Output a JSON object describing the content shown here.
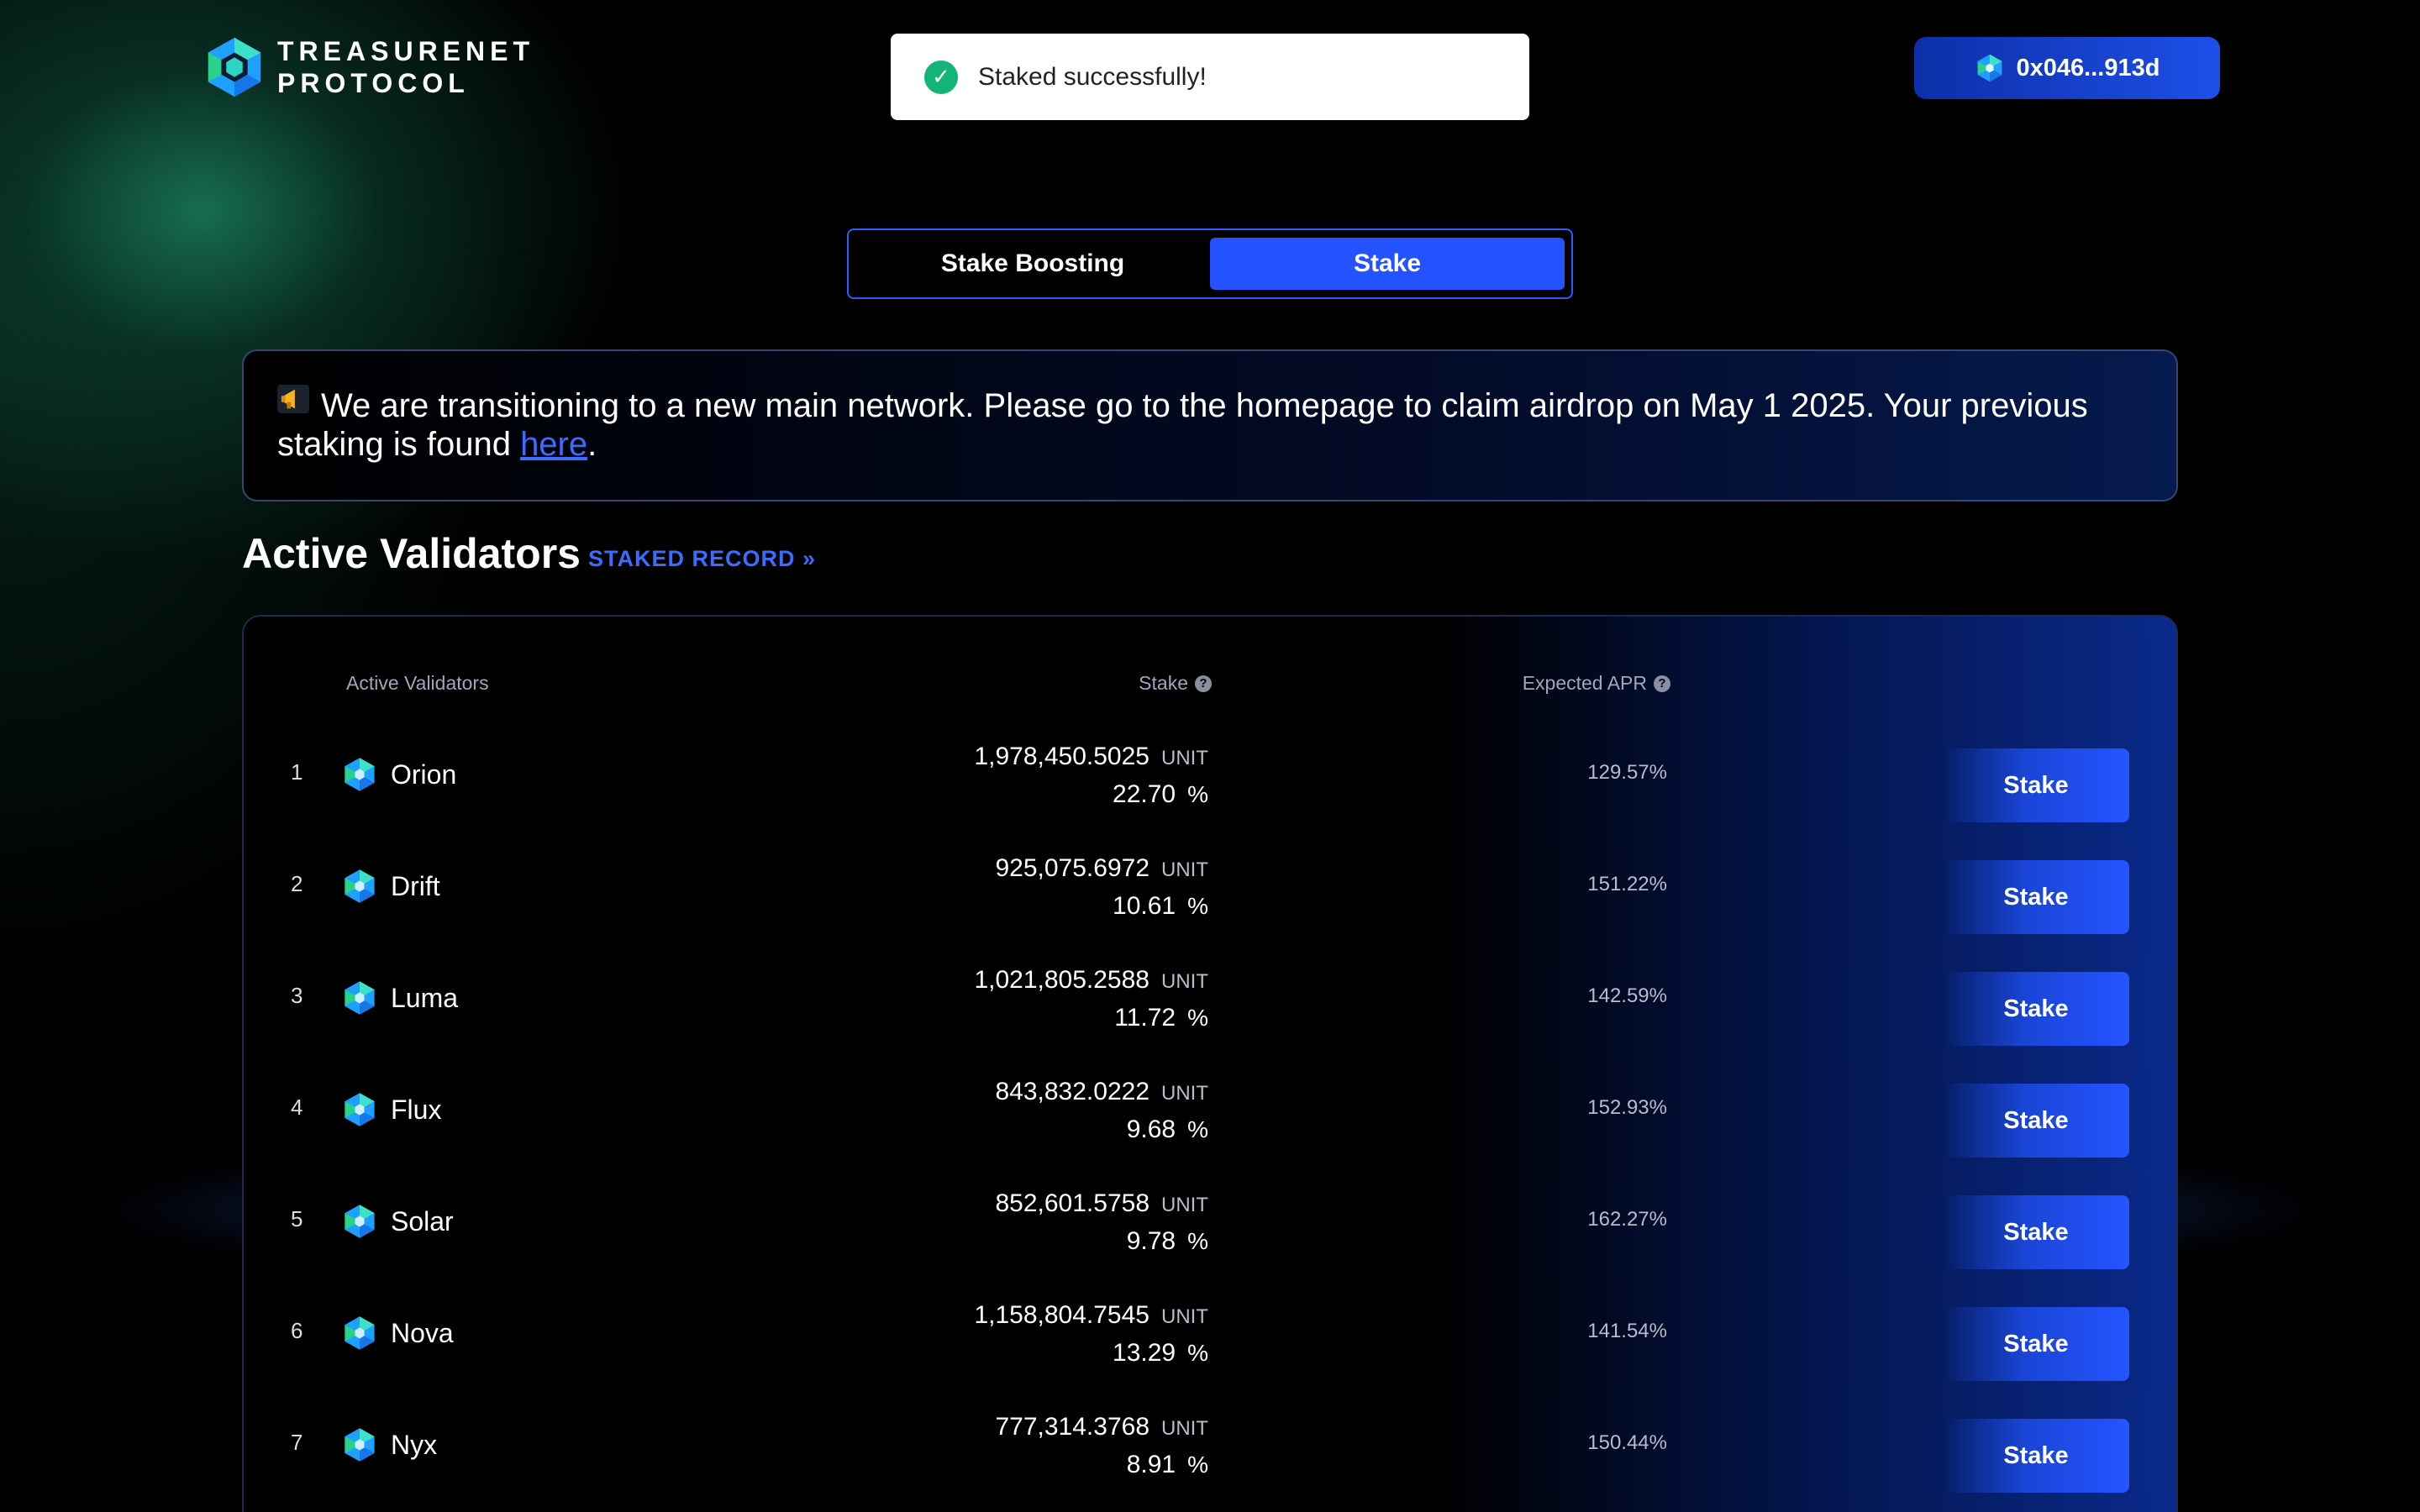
{
  "header": {
    "logo_line1": "TREASURENET",
    "logo_line2": "PROTOCOL",
    "wallet_address": "0x046...913d"
  },
  "toast": {
    "message": "Staked successfully!"
  },
  "tabs": [
    {
      "label": "Stake Boosting",
      "active": false
    },
    {
      "label": "Stake",
      "active": true
    }
  ],
  "banner": {
    "text": "We are transitioning to a new main network. Please go to the homepage to claim airdrop on May 1 2025. Your previous staking is found ",
    "link_text": "here",
    "end": "."
  },
  "section": {
    "title": "Active Validators",
    "record_link": "STAKED RECORD »"
  },
  "table": {
    "col_validators": "Active Validators",
    "col_stake": "Stake",
    "col_apr": "Expected APR",
    "unit_label": "UNIT",
    "pct_label": "%",
    "button_label": "Stake",
    "rows": [
      {
        "rank": "1",
        "name": "Orion",
        "amount": "1,978,450.5025",
        "percent": "22.70",
        "apr": "129.57%"
      },
      {
        "rank": "2",
        "name": "Drift",
        "amount": "925,075.6972",
        "percent": "10.61",
        "apr": "151.22%"
      },
      {
        "rank": "3",
        "name": "Luma",
        "amount": "1,021,805.2588",
        "percent": "11.72",
        "apr": "142.59%"
      },
      {
        "rank": "4",
        "name": "Flux",
        "amount": "843,832.0222",
        "percent": "9.68",
        "apr": "152.93%"
      },
      {
        "rank": "5",
        "name": "Solar",
        "amount": "852,601.5758",
        "percent": "9.78",
        "apr": "162.27%"
      },
      {
        "rank": "6",
        "name": "Nova",
        "amount": "1,158,804.7545",
        "percent": "13.29",
        "apr": "141.54%"
      },
      {
        "rank": "7",
        "name": "Nyx",
        "amount": "777,314.3768",
        "percent": "8.91",
        "apr": "150.44%"
      }
    ]
  },
  "colors": {
    "accent": "#2452ff",
    "link": "#3b6cff",
    "success": "#13b477"
  },
  "icons": {
    "logo": "treasurenet-logo-icon",
    "validator": "validator-cube-icon",
    "megaphone": "megaphone-icon",
    "check": "check-circle-icon"
  }
}
